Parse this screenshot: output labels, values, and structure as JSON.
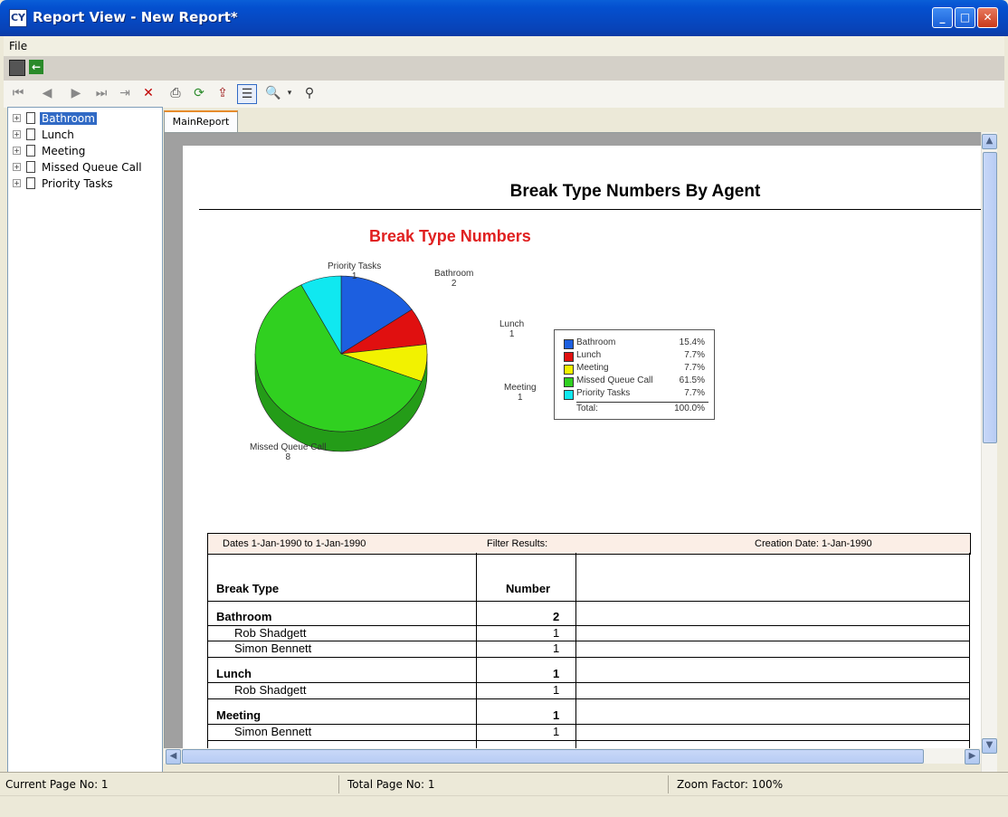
{
  "window": {
    "title": "Report View - New Report*",
    "icon": "CY"
  },
  "menu": {
    "file": "File"
  },
  "toolbar": {
    "icons": [
      "first-page-icon",
      "prev-page-icon",
      "next-page-icon",
      "last-page-icon",
      "goto-page-icon",
      "close-icon",
      "print-icon",
      "refresh-icon",
      "export-icon",
      "toggle-tree-icon",
      "zoom-icon",
      "search-icon"
    ]
  },
  "tree": {
    "items": [
      {
        "label": "Bathroom",
        "selected": true
      },
      {
        "label": "Lunch"
      },
      {
        "label": "Meeting"
      },
      {
        "label": "Missed Queue Call"
      },
      {
        "label": "Priority Tasks"
      }
    ]
  },
  "tabs": {
    "main": "MainReport"
  },
  "report": {
    "title": "Break Type Numbers By Agent",
    "header": {
      "dates": "Dates  1-Jan-1990 to  1-Jan-1990",
      "filter": "Filter Results:",
      "created": "Creation Date: 1-Jan-1990"
    },
    "columns": {
      "type": "Break Type",
      "number": "Number"
    },
    "groups": [
      {
        "name": "Bathroom",
        "total": "2",
        "rows": [
          {
            "name": "Rob Shadgett",
            "n": "1"
          },
          {
            "name": "Simon Bennett",
            "n": "1"
          }
        ]
      },
      {
        "name": "Lunch",
        "total": "1",
        "rows": [
          {
            "name": "Rob Shadgett",
            "n": "1"
          }
        ]
      },
      {
        "name": "Meeting",
        "total": "1",
        "rows": [
          {
            "name": "Simon Bennett",
            "n": "1"
          }
        ]
      }
    ]
  },
  "chart_data": {
    "type": "pie",
    "title": "Break Type Numbers",
    "categories": [
      "Bathroom",
      "Lunch",
      "Meeting",
      "Missed Queue Call",
      "Priority Tasks"
    ],
    "values": [
      2,
      1,
      1,
      8,
      1
    ],
    "percents": [
      "15.4%",
      "7.7%",
      "7.7%",
      "61.5%",
      "7.7%"
    ],
    "colors": [
      "#1c5fe0",
      "#e01010",
      "#f2f200",
      "#30d020",
      "#10e8f0"
    ],
    "slice_labels": [
      {
        "name": "Bathroom",
        "value": "2"
      },
      {
        "name": "Lunch",
        "value": "1"
      },
      {
        "name": "Meeting",
        "value": "1"
      },
      {
        "name": "Missed Queue Call",
        "value": "8"
      },
      {
        "name": "Priority Tasks",
        "value": "1"
      }
    ],
    "legend": {
      "position": "right",
      "total_label": "Total:",
      "total_value": "100.0%"
    }
  },
  "status": {
    "current": "Current Page No: 1",
    "total": "Total Page No: 1",
    "zoom": "Zoom Factor: 100%"
  }
}
